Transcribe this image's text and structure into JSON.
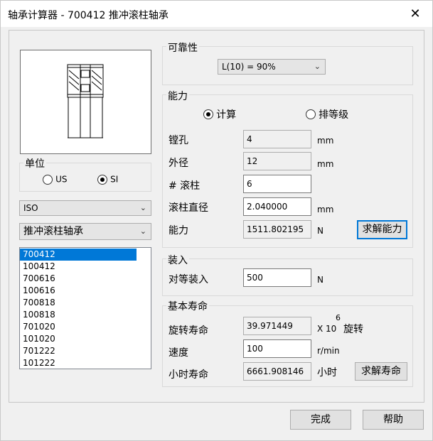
{
  "window": {
    "title": "轴承计算器 - 700412 推冲滚柱轴承",
    "close": "✕"
  },
  "units": {
    "title": "单位",
    "options": [
      {
        "label": "US",
        "checked": false
      },
      {
        "label": "SI",
        "checked": true
      }
    ]
  },
  "standard": {
    "value": "ISO"
  },
  "bearing_type": {
    "value": "推冲滚柱轴承"
  },
  "bearing_list": {
    "items": [
      "700412",
      "100412",
      "700616",
      "100616",
      "700818",
      "100818",
      "701020",
      "101020",
      "701222",
      "101222"
    ],
    "selected": 0
  },
  "reliability": {
    "title": "可靠性",
    "value": "L(10) = 90%"
  },
  "capacity": {
    "title": "能力",
    "mode_calc": "计算",
    "mode_rating": "排等级",
    "bore_label": "镗孔",
    "bore_value": "4",
    "bore_unit": "mm",
    "od_label": "外径",
    "od_value": "12",
    "od_unit": "mm",
    "rollers_label": "# 滚柱",
    "rollers_value": "6",
    "roller_dia_label": "滚柱直径",
    "roller_dia_value": "2.040000",
    "roller_dia_unit": "mm",
    "capacity_label": "能力",
    "capacity_value": "1511.802195",
    "capacity_unit": "N",
    "solve_button": "求解能力"
  },
  "load": {
    "title": "装入",
    "equiv_label": "对等装入",
    "equiv_value": "500",
    "equiv_unit": "N"
  },
  "life": {
    "title": "基本寿命",
    "rot_label": "旋转寿命",
    "rot_value": "39.971449",
    "rot_unit_base": "X 10",
    "rot_unit_exp": "6",
    "rot_unit_word": "旋转",
    "speed_label": "速度",
    "speed_value": "100",
    "speed_unit": "r/min",
    "hour_label": "小时寿命",
    "hour_value": "6661.908146",
    "hour_unit": "小时",
    "solve_button": "求解寿命"
  },
  "footer": {
    "done": "完成",
    "help": "帮助"
  }
}
